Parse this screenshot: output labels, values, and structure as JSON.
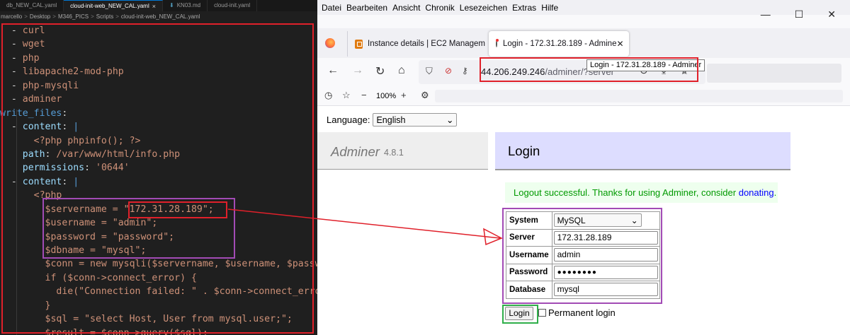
{
  "editor": {
    "tabs": [
      {
        "label": "db_NEW_CAL.yaml",
        "active": false
      },
      {
        "label": "cloud-init-web_NEW_CAL.yaml",
        "active": true
      },
      {
        "label": "KN03.md",
        "active": false
      },
      {
        "label": "cloud-init.yaml",
        "active": false
      }
    ],
    "close_glyph": "×",
    "breadcrumb": [
      "marcello",
      "Desktop",
      "M346_PICS",
      "Scripts",
      "cloud-init-web_NEW_CAL.yaml"
    ],
    "code_lines": [
      "  - curl",
      "  - wget",
      "  - php",
      "  - libapache2-mod-php",
      "  - php-mysqli",
      "  - adminer",
      "write_files:",
      "  - content: |",
      "      <?php phpinfo(); ?>",
      "    path: /var/www/html/info.php",
      "    permissions: '0644'",
      "  - content: |",
      "      <?php",
      "        $servername = \"172.31.28.189\";",
      "        $username = \"admin\";",
      "        $password = \"password\";",
      "        $dbname = \"mysql\";",
      "        $conn = new mysqli($servername, $username, $password",
      "        if ($conn->connect_error) {",
      "          die(\"Connection failed: \" . $conn->connect_error",
      "        }",
      "        $sql = \"select Host, User from mysql.user;\";",
      "        $result = $conn->query($sql);"
    ],
    "colors": {
      "keyword": "#569cd6",
      "string": "#ce9178",
      "key": "#9cdcfe",
      "text": "#d4d4d4"
    }
  },
  "browser": {
    "menu": [
      "Datei",
      "Bearbeiten",
      "Ansicht",
      "Chronik",
      "Lesezeichen",
      "Extras",
      "Hilfe"
    ],
    "tabs": [
      {
        "label": "Instance details | EC2 Managem",
        "icon": "aws-icon"
      },
      {
        "label": "Login - 172.31.28.189 - Admine",
        "icon": "adminer-icon",
        "active": true
      }
    ],
    "url_host": "44.206.249.246",
    "url_path": "/adminer/?server",
    "tooltip": "Login - 172.31.28.189 - Adminer",
    "zoom": "100%"
  },
  "page": {
    "language_label": "Language:",
    "language_value": "English",
    "adminer_title": "Adminer",
    "adminer_version": "4.8.1",
    "login_heading": "Login",
    "message": "Logout successful. Thanks for using Adminer, consider ",
    "message_link": "donating",
    "message_end": ".",
    "form": {
      "system_label": "System",
      "system_value": "MySQL",
      "server_label": "Server",
      "server_value": "172.31.28.189",
      "username_label": "Username",
      "username_value": "admin",
      "password_label": "Password",
      "password_value": "●●●●●●●●",
      "database_label": "Database",
      "database_value": "mysql"
    },
    "login_button": "Login",
    "permanent_label": "Permanent login"
  },
  "annotations": {
    "red": "#e0202a",
    "purple": "#a24bb5",
    "green": "#2fae4a"
  }
}
